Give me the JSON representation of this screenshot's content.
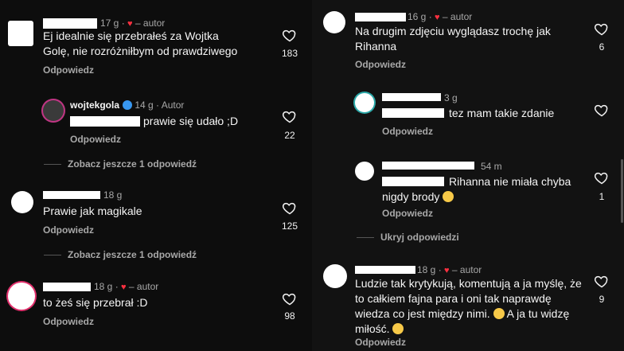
{
  "left": {
    "comments": [
      {
        "meta": "17 g · ",
        "author_tag": "– autor",
        "text": "Ej idealnie się przebrałeś za Wojtka Golę, nie rozróżniłbym od prawdziwego",
        "reply": "Odpowiedz",
        "likes": "183"
      },
      {
        "username": "wojtekgola",
        "meta": "14 g · Autor",
        "text": "prawie się udało ;D",
        "reply": "Odpowiedz",
        "likes": "22"
      },
      {
        "meta": "18 g",
        "text": "Prawie jak magikale",
        "reply": "Odpowiedz",
        "likes": "125"
      },
      {
        "meta": "18 g · ",
        "author_tag": "– autor",
        "text": "to żeś się przebrał :D",
        "reply": "Odpowiedz",
        "likes": "98"
      }
    ],
    "more_1": "Zobacz jeszcze 1 odpowiedź",
    "more_2": "Zobacz jeszcze 1 odpowiedź"
  },
  "right": {
    "comments": [
      {
        "meta": "16 g · ",
        "author_tag": "– autor",
        "text": "Na drugim zdjęciu wyglądasz trochę jak Rihanna",
        "reply": "Odpowiedz",
        "likes": "6"
      },
      {
        "meta": "3 g",
        "text": "tez mam takie zdanie",
        "reply": "Odpowiedz",
        "likes": ""
      },
      {
        "meta": "54 m",
        "text": "Rihanna nie miała chyba nigdy brody",
        "reply": "Odpowiedz",
        "likes": "1"
      },
      {
        "meta": "18 g · ",
        "author_tag": "– autor",
        "text1": "Ludzie tak krytykują, komentują a ja myślę, że to całkiem fajna para i oni tak naprawdę wiedza co jest między nimi.",
        "text2": "A ja tu widzę miłość.",
        "reply": "Odpowiedz",
        "likes": "9"
      }
    ],
    "hide_replies": "Ukryj odpowiedzi"
  },
  "icons": {
    "like": "heart-outline-icon",
    "author_heart": "heart-filled-icon"
  },
  "colors": {
    "background": "#0c0c0c",
    "secondary_text": "#a8a8a8",
    "heart": "#ff3040",
    "verified": "#3897f0"
  }
}
